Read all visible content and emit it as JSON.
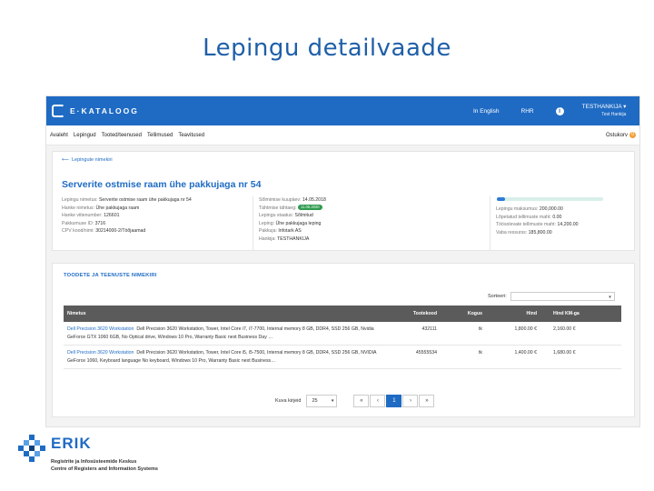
{
  "slide": {
    "title": "Lepingu detailvaade"
  },
  "app": {
    "logo_text": "E·KATALOOG",
    "topnav": {
      "lang": "In English",
      "rhr": "RHR",
      "user_name": "TESTHANKIJA ▾",
      "user_sub": "Test Hankija"
    },
    "accent": "#1f6bc4"
  },
  "menu": {
    "items": [
      "Avaleht",
      "Lepingud",
      "Tooted/teenused",
      "Tellimused",
      "Teavitused"
    ],
    "cart_label": "Ostukorv",
    "cart_count": "0"
  },
  "contract": {
    "back_link": "Lepingute nimekiri",
    "title": "Serverite ostmise raam ühe pakkujaga nr 54",
    "col1": [
      {
        "label": "Lepingu nimetus:",
        "value": "Serverite ostmise raam ühe pakkujaga nr 54"
      },
      {
        "label": "Hanke nimetus:",
        "value": "Ühe pakkujaga raam"
      },
      {
        "label": "Hanke viitenumber:",
        "value": "126601"
      },
      {
        "label": "Pakkumuse ID:",
        "value": "3716"
      },
      {
        "label": "CPV kood/nimi:",
        "value": "30214000-2/Töõjaamad"
      }
    ],
    "col2": [
      {
        "label": "Sõlmimise kuupäev:",
        "value": "14.05.2018"
      },
      {
        "label": "Tähtmise tähtaeg:",
        "value": "",
        "badge": "11.05.2020"
      },
      {
        "label": "Lepingu staatus:",
        "value": "Sõlmitud"
      },
      {
        "label": "Leping:",
        "value": "Ühe pakkujaga leping"
      },
      {
        "label": "Pakkuja:",
        "value": "Infotark AS"
      },
      {
        "label": "Hankija:",
        "value": "TESTHANKIJA"
      }
    ],
    "progress": 0.08,
    "col3": [
      {
        "label": "Lepingu maksumus:",
        "value": "200,000.00"
      },
      {
        "label": "Lõpetatud tellimuste maht:",
        "value": "0.00"
      },
      {
        "label": "Töösolevate tellimuste maht:",
        "value": "14,200.00"
      },
      {
        "label": "Vaba ressurss:",
        "value": "185,800.00"
      }
    ]
  },
  "products": {
    "section_title": "TOODETE JA TEENUSTE NIMEKIRI",
    "sort_label": "Sorteeri:",
    "headers": [
      "Nimetus",
      "Tootekood",
      "Kogus",
      "Hind",
      "Hind KM-ga"
    ],
    "rows": [
      {
        "name": "Dell Precision 3620 Workstation",
        "desc": "Dell Precision 3620 Workstation, Tower, Intel Core i7, i7-7700, Internal memory 8 GB, DDR4, SSD 256 GB, Nvidia GeForce GTX 1060 6GB, No Optical drive, Windows 10 Pro, Warranty Basic next Business Day …",
        "code": "432111",
        "unit": "tk",
        "price": "1,800.00 €",
        "price_vat": "2,160.00 €"
      },
      {
        "name": "Dell Precision 3620 Workstation",
        "desc": "Dell Precision 3620 Workstation, Tower, Intel Core i5, i5-7500, Internal memory 8 GB, DDR4, SSD 256 GB, NVIDIA GeForce 1060, Keyboard language No keyboard, Windows 10 Pro, Warranty Basic next Business…",
        "code": "45555534",
        "unit": "tk",
        "price": "1,400.00 €",
        "price_vat": "1,680.00 €"
      }
    ],
    "pager": {
      "label": "Kuva kirjeid",
      "per_page": "25",
      "first": "«",
      "prev": "‹",
      "current": "1",
      "next": "›",
      "last": "»"
    }
  },
  "footer": {
    "logo_word": "ERIK",
    "line1": "Registrite ja Infosüsteemide Keskus",
    "line2": "Centre of Registers and Information Systems"
  }
}
